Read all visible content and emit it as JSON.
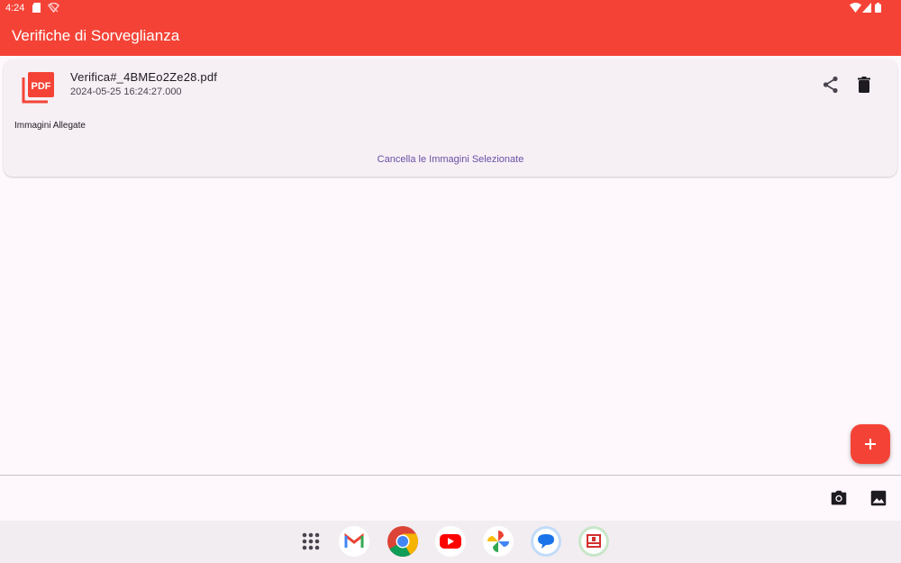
{
  "status": {
    "time": "4:24",
    "icons": [
      "sd-card-icon",
      "notification-icon",
      "wifi-icon",
      "signal-icon",
      "battery-icon"
    ]
  },
  "app": {
    "title": "Verifiche di Sorveglianza",
    "accent_color": "#f44336",
    "link_color": "#6750a4"
  },
  "file_card": {
    "icon": "pdf-file-icon",
    "file_name": "Verifica#_4BMEo2Ze28.pdf",
    "date": "2024-05-25 16:24:27.000",
    "actions": [
      "share-icon",
      "delete-icon"
    ],
    "attached_images_label": "Immagini Allegate",
    "clear_selected_button": "Cancella le Immagini Selezionate"
  },
  "fab": {
    "icon": "plus-icon"
  },
  "bottom_bar": {
    "actions": [
      "camera-icon",
      "gallery-icon"
    ]
  },
  "taskbar": {
    "apps": [
      "app-drawer",
      "Gmail",
      "Chrome",
      "YouTube",
      "Photos",
      "Messages",
      "Verifiche app"
    ]
  }
}
